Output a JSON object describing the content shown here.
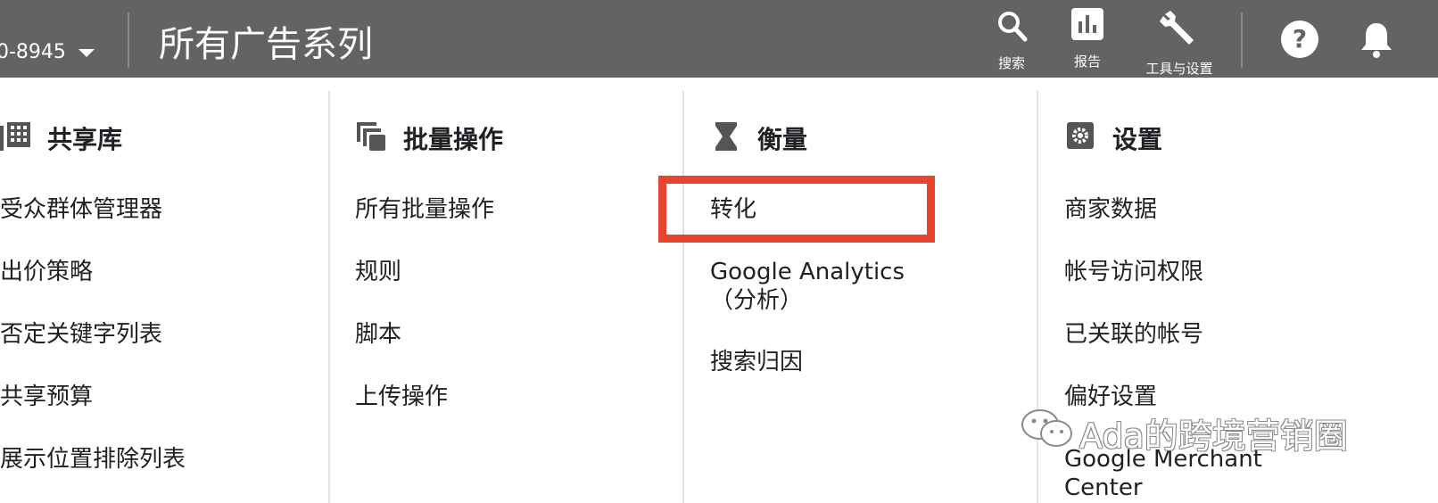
{
  "header": {
    "account_id": "0-8945",
    "title": "所有广告系列",
    "tools": [
      {
        "icon": "search-icon",
        "label": "搜索"
      },
      {
        "icon": "reports-icon",
        "label": "报告"
      },
      {
        "icon": "wrench-icon",
        "label": "工具与设置"
      },
      {
        "icon": "help-icon",
        "label": ""
      },
      {
        "icon": "bell-icon",
        "label": ""
      }
    ]
  },
  "columns": {
    "shared_library": {
      "icon": "grid-library-icon",
      "title": "共享库",
      "items": [
        "受众群体管理器",
        "出价策略",
        "否定关键字列表",
        "共享预算",
        "展示位置排除列表"
      ]
    },
    "bulk_actions": {
      "icon": "stacked-pages-icon",
      "title": "批量操作",
      "items": [
        "所有批量操作",
        "规则",
        "脚本",
        "上传操作"
      ]
    },
    "measurement": {
      "icon": "hourglass-icon",
      "title": "衡量",
      "items": [
        "转化",
        "Google Analytics（分析）",
        "搜索归因"
      ]
    },
    "settings": {
      "icon": "gear-icon",
      "title": "设置",
      "items": [
        "商家数据",
        "帐号访问权限",
        "已关联的帐号",
        "偏好设置",
        "Google Merchant Center"
      ]
    }
  },
  "watermark": {
    "text": "Ada的跨境营销圈",
    "icon": "wechat-icon"
  },
  "colors": {
    "topbar": "#636363",
    "highlight": "#e8432c",
    "divider": "#e2e2e2"
  }
}
